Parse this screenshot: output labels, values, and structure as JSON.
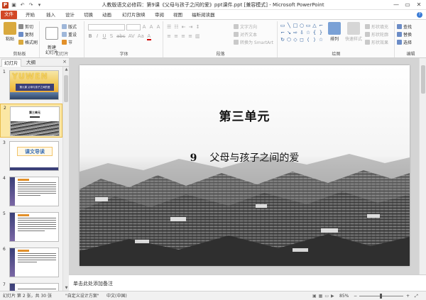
{
  "titlebar": {
    "title": "人教版语文必修四：第9课《父母与孩子之间的爱》ppt课件.ppt [兼容模式] - Microsoft PowerPoint",
    "app_icon": "P",
    "qat_icons": [
      "save-icon",
      "undo-icon",
      "redo-icon",
      "customize-icon"
    ],
    "controls": [
      "—",
      "▭",
      "✕"
    ]
  },
  "tabs": {
    "file": "文件",
    "items": [
      "开始",
      "插入",
      "设计",
      "切换",
      "动画",
      "幻灯片放映",
      "审阅",
      "视图",
      "福昕阅读器"
    ],
    "help": "?"
  },
  "ribbon": {
    "clipboard": {
      "paste": "粘贴",
      "cut": "剪切",
      "copy": "复制",
      "format_painter": "格式刷",
      "label": "剪贴板"
    },
    "slides": {
      "new_slide": "新建\n幻灯片",
      "layout": "版式",
      "reset": "重设",
      "section": "节",
      "label": "幻灯片"
    },
    "font": {
      "label": "字体",
      "font_name": "",
      "font_size": "",
      "grow": "A",
      "shrink": "A",
      "clear": "A",
      "bold": "B",
      "italic": "I",
      "underline": "U",
      "shadow": "S",
      "strike": "abc",
      "spacing": "AV",
      "case": "Aa",
      "color": "A"
    },
    "paragraph": {
      "label": "段落",
      "text_direction": "文字方向",
      "align_text": "对齐文本",
      "smartart": "转换为 SmartArt"
    },
    "drawing": {
      "label": "绘图",
      "arrange": "排列",
      "quick_styles": "快速样式",
      "shape_fill": "形状填充",
      "shape_outline": "形状轮廓",
      "shape_effects": "形状效果",
      "shapes": [
        "▭",
        "╲",
        "□",
        "○",
        "▭",
        "△",
        "⌐",
        "⌐",
        "↘",
        "⇨",
        "⇩",
        "☆",
        "{",
        "}",
        "↻",
        "⬡",
        "◇",
        "◻",
        "⟨",
        "⟩",
        "☆"
      ]
    },
    "editing": {
      "find": "查找",
      "replace": "替换",
      "select": "选择",
      "label": "编辑"
    }
  },
  "leftpanel": {
    "tab_slides": "幻灯片",
    "tab_outline": "大纲",
    "close": "×",
    "slides": [
      {
        "num": "1",
        "caption_main": "YUWEN",
        "caption_band": "第九课 父母与孩子之间的爱"
      },
      {
        "num": "2",
        "caption_main": "第三单元"
      },
      {
        "num": "3",
        "caption_main": "课文导读"
      },
      {
        "num": "4"
      },
      {
        "num": "5"
      },
      {
        "num": "6"
      },
      {
        "num": "7"
      }
    ]
  },
  "slide": {
    "title": "第三单元",
    "number": "9",
    "subtitle": "父母与孩子之间的爱"
  },
  "notes": {
    "placeholder": "单击此处添加备注"
  },
  "statusbar": {
    "slide_info": "幻灯片 第 2 张，共 30 张",
    "theme": "\"自定义设计方案\"",
    "language": "中文(中国)",
    "zoom": "85%",
    "zoom_out": "−",
    "zoom_in": "+",
    "fit": "⤢"
  },
  "colors": {
    "accent": "#d24726",
    "selected_thumb": "#fbe7a4",
    "ribbon": "#fbfbfb"
  }
}
